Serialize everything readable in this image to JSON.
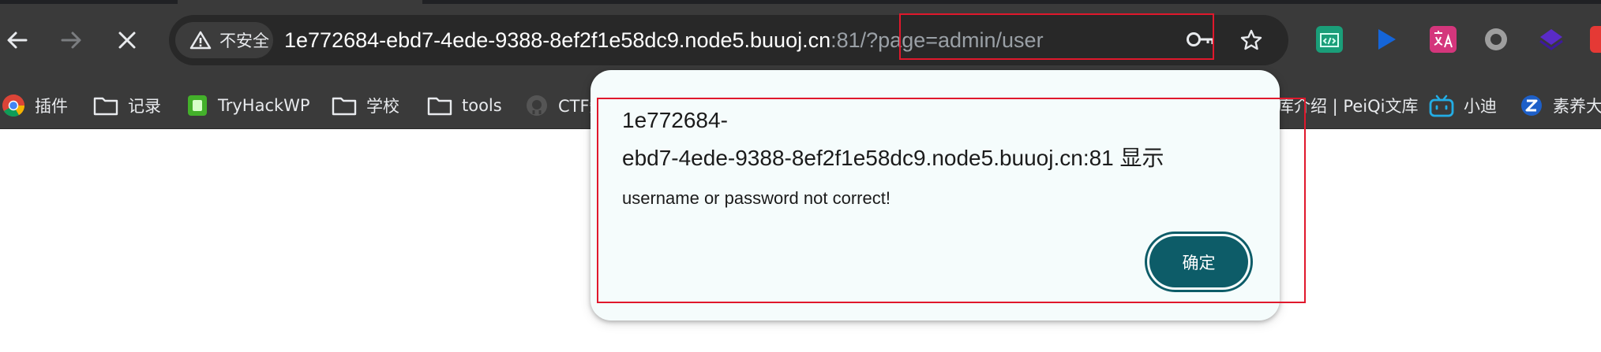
{
  "browser": {
    "security": {
      "label": "不安全",
      "icon": "warning-triangle-icon"
    },
    "url": {
      "host": "1e772684-ebd7-4ede-9388-8ef2f1e58dc9.node5.buuoj.cn",
      "rest": ":81/?page=admin/user"
    },
    "nav_icons": [
      "back-arrow-icon",
      "forward-arrow-icon",
      "stop-loading-icon"
    ],
    "omnibox_icons": [
      "password-key-icon",
      "bookmark-star-icon"
    ],
    "extensions": [
      {
        "name": "code-extension-icon",
        "color": "#1a9e79"
      },
      {
        "name": "play-extension-icon",
        "color": "#1565d8"
      },
      {
        "name": "translate-extension-icon",
        "color": "#d4367c"
      },
      {
        "name": "circle-extension-icon",
        "color": "#9e9e9e"
      },
      {
        "name": "layers-extension-icon",
        "color": "#5a2bc7"
      },
      {
        "name": "red-extension-icon",
        "color": "#e53935"
      }
    ]
  },
  "bookmarks": [
    {
      "label": "插件",
      "icon": "chrome-icon"
    },
    {
      "label": "记录",
      "icon": "folder-icon"
    },
    {
      "label": "TryHackWP",
      "icon": "green-app-icon"
    },
    {
      "label": "学校",
      "icon": "folder-icon"
    },
    {
      "label": "tools",
      "icon": "folder-icon"
    },
    {
      "label": "CTF知",
      "icon": "github-icon"
    },
    {
      "label": "库介绍 | PeiQi文库",
      "icon": ""
    },
    {
      "label": "小迪",
      "icon": "bilibili-icon"
    },
    {
      "label": "素养大赛",
      "icon": "z-logo-icon"
    }
  ],
  "dialog": {
    "origin_line1": "1e772684-",
    "origin_line2": "ebd7-4ede-9388-8ef2f1e58dc9.node5.buuoj.cn:81 显示",
    "message": "username or password not correct!",
    "ok_label": "确定"
  },
  "colors": {
    "toolbar": "#3a3a3a",
    "omnibox": "#282828",
    "dialog_bg": "#f5fcfc",
    "ok_button": "#0d5c68",
    "highlight_box": "#e0182c"
  }
}
